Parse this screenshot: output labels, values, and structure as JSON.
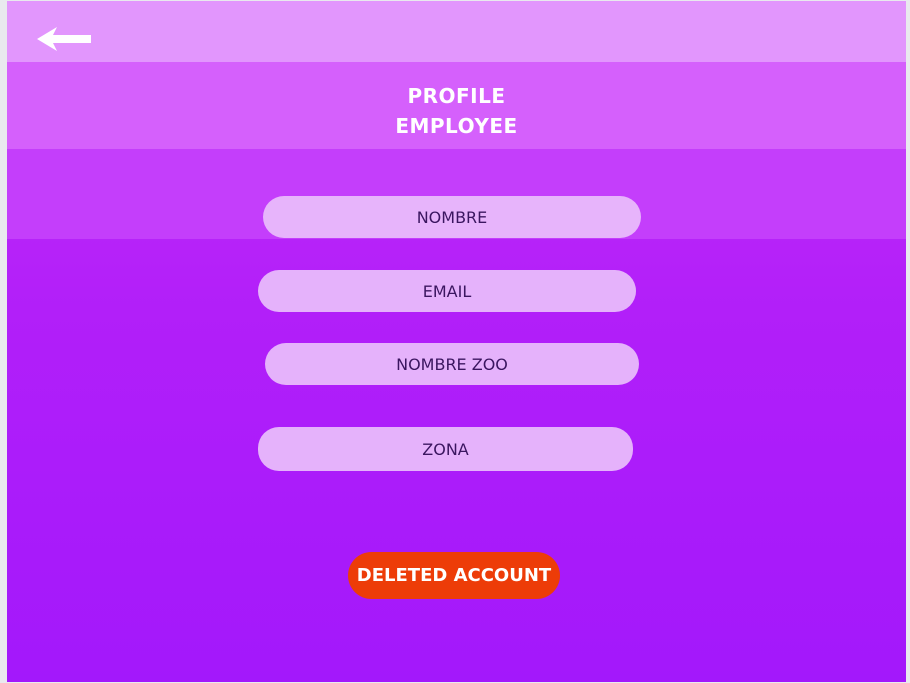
{
  "header": {
    "back_icon": "arrow-left-icon",
    "title_line1": "PROFILE",
    "title_line2": "EMPLOYEE"
  },
  "form": {
    "fields": [
      {
        "placeholder": "NOMBRE",
        "value": ""
      },
      {
        "placeholder": "EMAIL",
        "value": ""
      },
      {
        "placeholder": "NOMBRE ZOO",
        "value": ""
      },
      {
        "placeholder": "ZONA",
        "value": ""
      }
    ]
  },
  "actions": {
    "delete_label": "DELETED ACCOUNT"
  },
  "colors": {
    "top_bar": "#e296fd",
    "title_band": "#d560fc",
    "background": "#b21ff9",
    "field_fill": "#e5b2fb",
    "delete_button": "#ed3c08"
  }
}
